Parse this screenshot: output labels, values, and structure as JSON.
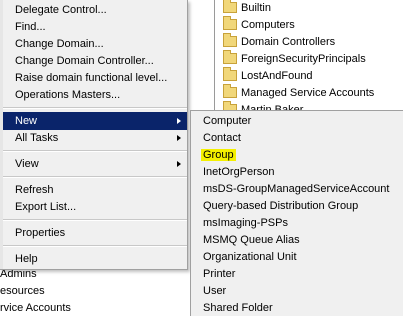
{
  "background_tree": {
    "rows": [
      "Admins",
      "esources",
      "rvice Accounts"
    ]
  },
  "folder_list": {
    "items": [
      "Builtin",
      "Computers",
      "Domain Controllers",
      "ForeignSecurityPrincipals",
      "LostAndFound",
      "Managed Service Accounts",
      "Martin Baker"
    ]
  },
  "context_menu": {
    "items": [
      {
        "label": "Delegate Control...",
        "type": "item"
      },
      {
        "label": "Find...",
        "type": "item"
      },
      {
        "label": "Change Domain...",
        "type": "item"
      },
      {
        "label": "Change Domain Controller...",
        "type": "item"
      },
      {
        "label": "Raise domain functional level...",
        "type": "item"
      },
      {
        "label": "Operations Masters...",
        "type": "item"
      },
      {
        "label": "New",
        "type": "submenu",
        "selected": true
      },
      {
        "label": "All Tasks",
        "type": "submenu"
      },
      {
        "label": "View",
        "type": "submenu"
      },
      {
        "label": "Refresh",
        "type": "item"
      },
      {
        "label": "Export List...",
        "type": "item"
      },
      {
        "label": "Properties",
        "type": "item"
      },
      {
        "label": "Help",
        "type": "item"
      }
    ]
  },
  "new_submenu": {
    "items": [
      "Computer",
      "Contact",
      "Group",
      "InetOrgPerson",
      "msDS-GroupManagedServiceAccount",
      "Query-based Distribution Group",
      "msImaging-PSPs",
      "MSMQ Queue Alias",
      "Organizational Unit",
      "Printer",
      "User",
      "Shared Folder"
    ],
    "highlighted": "Group"
  },
  "colors": {
    "menu_bg": "#f0f0f0",
    "selection": "#0a246a",
    "highlight": "#f4f000",
    "folder": "#f1d77a"
  }
}
